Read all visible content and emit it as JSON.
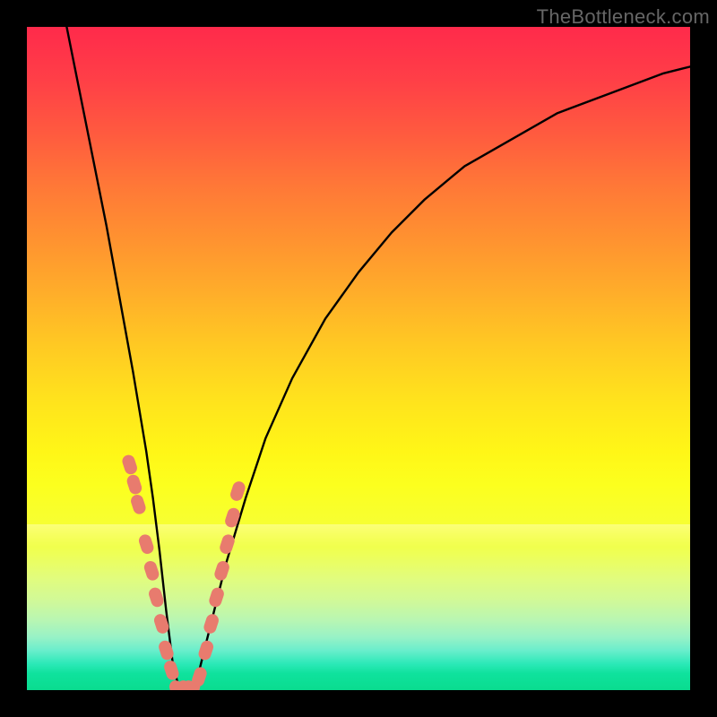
{
  "watermark_text": "TheBottleneck.com",
  "chart_data": {
    "type": "line",
    "title": "",
    "xlabel": "",
    "ylabel": "",
    "xlim": [
      0,
      100
    ],
    "ylim": [
      0,
      100
    ],
    "grid": false,
    "legend": false,
    "background_gradient": {
      "top": "#ff2a4b",
      "mid": "#ffe21d",
      "bottom": "#0adc8f",
      "note": "red at top through orange and yellow to green at bottom"
    },
    "series": [
      {
        "name": "bottleneck-curve",
        "color": "#000000",
        "x": [
          6,
          8,
          10,
          12,
          14,
          16,
          18,
          19,
          20,
          21,
          22,
          23,
          24,
          25,
          26,
          28,
          30,
          33,
          36,
          40,
          45,
          50,
          55,
          60,
          66,
          73,
          80,
          88,
          96,
          100
        ],
        "y": [
          100,
          90,
          80,
          70,
          59,
          48,
          36,
          29,
          21,
          12,
          4,
          0,
          0,
          0,
          3,
          11,
          19,
          29,
          38,
          47,
          56,
          63,
          69,
          74,
          79,
          83,
          87,
          90,
          93,
          94
        ]
      }
    ],
    "highlight_points": {
      "name": "pink-dots",
      "color": "#e87b6e",
      "note": "clustered salmon markers around the curve minimum",
      "x": [
        15.5,
        16.2,
        16.8,
        18.0,
        18.8,
        19.5,
        20.3,
        21.0,
        21.8,
        22.6,
        23.4,
        24.2,
        25.0,
        26.0,
        27.0,
        27.8,
        28.6,
        29.4,
        30.2,
        31.0,
        31.8
      ],
      "y": [
        34,
        31,
        28,
        22,
        18,
        14,
        10,
        6,
        3,
        0,
        0,
        0,
        0,
        2,
        6,
        10,
        14,
        18,
        22,
        26,
        30
      ]
    }
  }
}
